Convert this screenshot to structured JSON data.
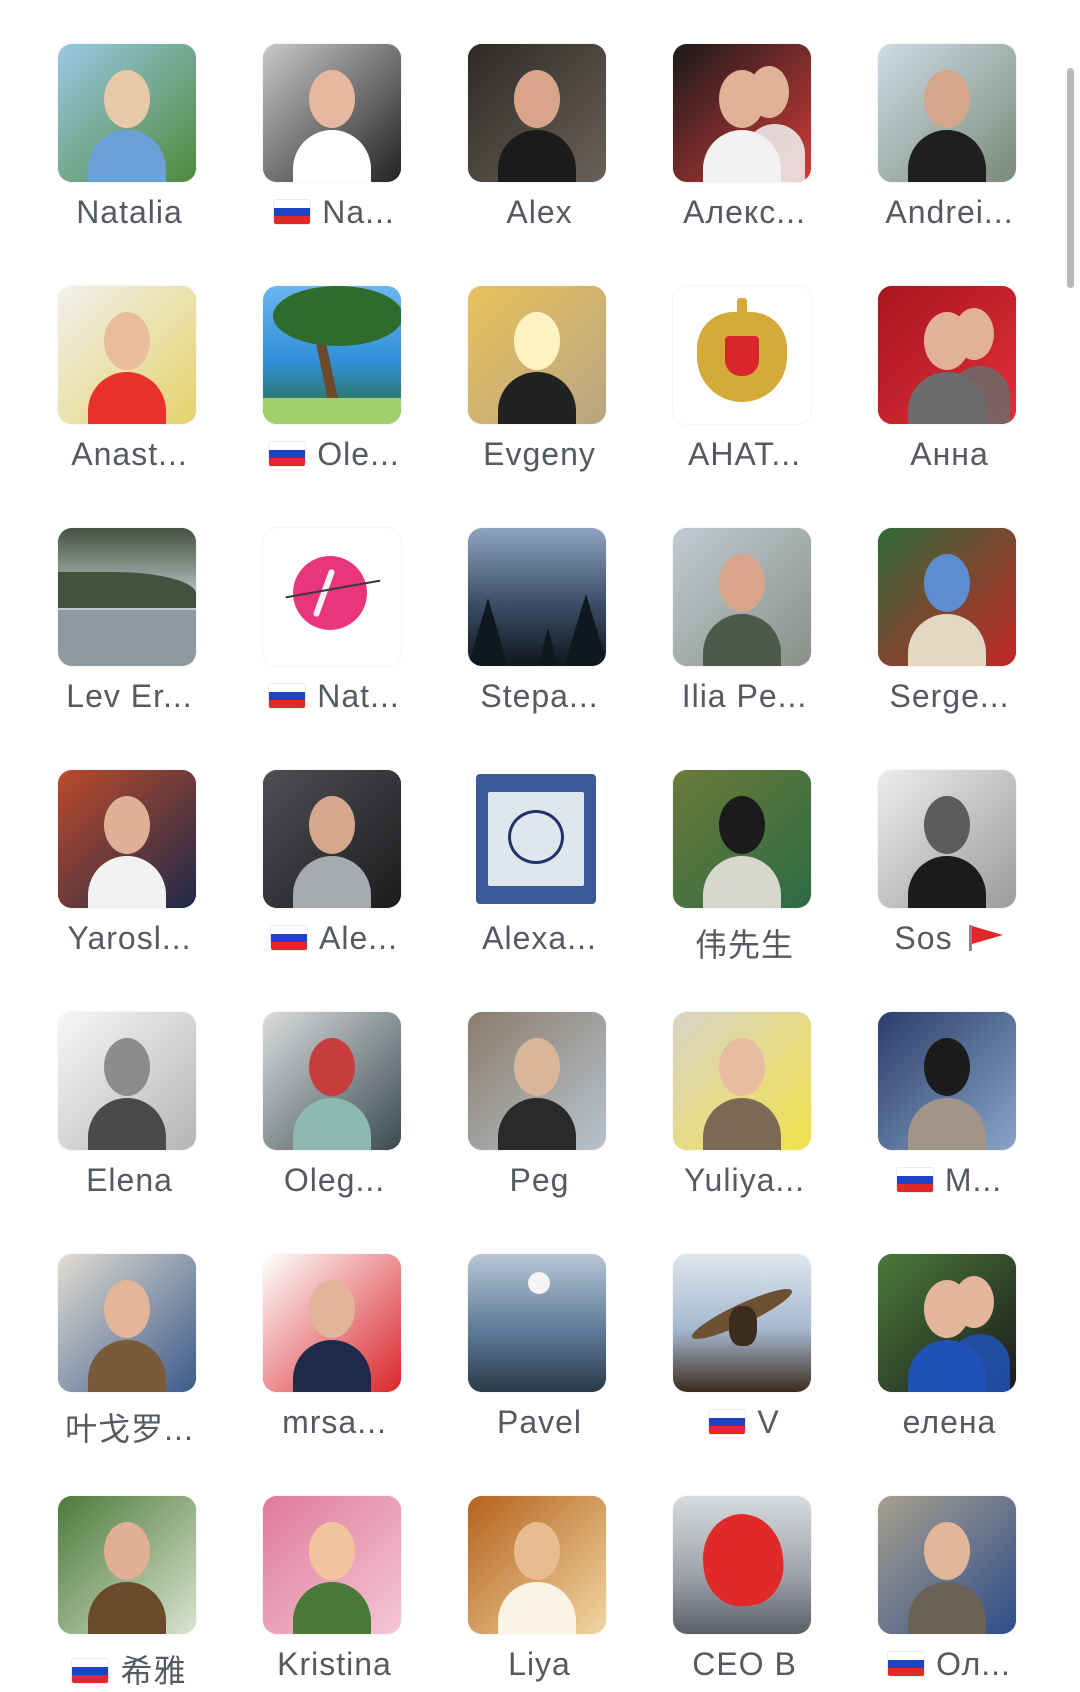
{
  "contacts": [
    {
      "name": "Natalia",
      "flag": false,
      "avatar": "woman-portrait",
      "colors": [
        "#9cc7e6",
        "#4f8a3b",
        "#6aa1d9",
        "#e7c9a8"
      ]
    },
    {
      "name": "Na...",
      "flag": true,
      "avatar": "woman-portrait",
      "colors": [
        "#c9c9c9",
        "#222222",
        "#ffffff",
        "#e6b8a0"
      ]
    },
    {
      "name": "Alex",
      "flag": false,
      "avatar": "man-portrait",
      "colors": [
        "#2d2a26",
        "#6b6158",
        "#1b1b1b",
        "#d9a58a"
      ]
    },
    {
      "name": "Алекс...",
      "flag": false,
      "avatar": "fighters",
      "colors": [
        "#1a1a1a",
        "#d23b3b",
        "#f2f2f2",
        "#e2b197"
      ]
    },
    {
      "name": "Andrei...",
      "flag": false,
      "avatar": "man-outdoor",
      "colors": [
        "#cfdbe6",
        "#7a8a7a",
        "#1f1f1f",
        "#d6a68a"
      ]
    },
    {
      "name": "Anast...",
      "flag": false,
      "avatar": "woman-red-dress",
      "colors": [
        "#f1f1ef",
        "#e5d26a",
        "#e8322b",
        "#e8bc9d"
      ]
    },
    {
      "name": "Ole...",
      "flag": true,
      "avatar": "palm-tree",
      "colors": [
        "#2f8fd8",
        "#6ab6ee",
        "#2f6b2a",
        "#a0d16f"
      ]
    },
    {
      "name": "Evgeny",
      "flag": false,
      "avatar": "man-corridor",
      "colors": [
        "#e9c25b",
        "#b9a584",
        "#222222",
        "#fff3c4"
      ]
    },
    {
      "name": "АНАТ...",
      "flag": false,
      "avatar": "coat-of-arms",
      "colors": [
        "#ffffff",
        "#d4aa3a",
        "#d8262b",
        "#1f3a8a"
      ]
    },
    {
      "name": "Анна",
      "flag": false,
      "avatar": "couple",
      "colors": [
        "#a8141e",
        "#e0303a",
        "#6b6b6b",
        "#e2b197"
      ]
    },
    {
      "name": "Lev Er...",
      "flag": false,
      "avatar": "misty-river",
      "colors": [
        "#c8cfd4",
        "#43513f",
        "#8f9aa0",
        "#5a6b5c"
      ]
    },
    {
      "name": "Nat...",
      "flag": true,
      "avatar": "ballet-logo",
      "colors": [
        "#ffffff",
        "#e8357b",
        "#3a3a3a",
        "#f4f4f4"
      ]
    },
    {
      "name": "Stepa...",
      "flag": false,
      "avatar": "night-forest",
      "colors": [
        "#3b4d67",
        "#8ea4c0",
        "#10181f",
        "#c7d2de"
      ]
    },
    {
      "name": "Ilia Pe...",
      "flag": false,
      "avatar": "man-waterfront",
      "colors": [
        "#c1ccd2",
        "#8a8f88",
        "#4d5a4a",
        "#d8a58a"
      ]
    },
    {
      "name": "Serge...",
      "flag": false,
      "avatar": "man-temple",
      "colors": [
        "#2f6a3a",
        "#c32826",
        "#e3d9c3",
        "#5c8ecf"
      ]
    },
    {
      "name": "Yarosl...",
      "flag": false,
      "avatar": "man-suit",
      "colors": [
        "#bd4a2a",
        "#1e2a4a",
        "#f2f2f2",
        "#e0b096"
      ]
    },
    {
      "name": "Ale...",
      "flag": true,
      "avatar": "man-cockpit",
      "colors": [
        "#4d4f52",
        "#1b1c1e",
        "#a7aaae",
        "#d5a78d"
      ]
    },
    {
      "name": "Alexa...",
      "flag": false,
      "avatar": "postage-stamp",
      "colors": [
        "#3b5a9a",
        "#dfe6f0",
        "#ffffff",
        "#1f3466"
      ]
    },
    {
      "name": "伟先生",
      "flag": false,
      "avatar": "man-mahjong",
      "colors": [
        "#6b7a3a",
        "#2d6b43",
        "#d6d8cf",
        "#1b1b1b"
      ]
    },
    {
      "name": "Sos",
      "flag": false,
      "trailing_flag": true,
      "avatar": "man-bw",
      "colors": [
        "#ececec",
        "#9b9b9b",
        "#1b1b1b",
        "#5c5c5c"
      ]
    },
    {
      "name": "Elena",
      "flag": false,
      "avatar": "woman-sketch",
      "colors": [
        "#f7f7f7",
        "#b5b5b5",
        "#4a4a4a",
        "#8c8c8c"
      ]
    },
    {
      "name": "Oleg...",
      "flag": false,
      "avatar": "man-mall",
      "colors": [
        "#dcdcdc",
        "#3a4b52",
        "#8fb9b0",
        "#c73c3c"
      ]
    },
    {
      "name": "Peg",
      "flag": false,
      "avatar": "man-old-town",
      "colors": [
        "#8b7d6c",
        "#b7c3cf",
        "#2a2a2a",
        "#d9b59a"
      ]
    },
    {
      "name": "Yuliya...",
      "flag": false,
      "avatar": "woman-selfie",
      "colors": [
        "#d9d4c8",
        "#f2e24a",
        "#7a6a55",
        "#e8bca0"
      ]
    },
    {
      "name": "M...",
      "flag": true,
      "avatar": "statue",
      "colors": [
        "#2a3e6a",
        "#8aa4c8",
        "#a39488",
        "#1b1b1b"
      ]
    },
    {
      "name": "叶戈罗...",
      "flag": false,
      "avatar": "man-temple-of-heaven",
      "colors": [
        "#e2ddd2",
        "#3b5a8a",
        "#7a5a3a",
        "#e3b699"
      ]
    },
    {
      "name": "mrsa...",
      "flag": false,
      "avatar": "man-podium",
      "colors": [
        "#ffffff",
        "#d8262b",
        "#1f2a4a",
        "#e2b59a"
      ]
    },
    {
      "name": "Pavel",
      "flag": false,
      "avatar": "sea-sunset",
      "colors": [
        "#5e7a98",
        "#b8c7d6",
        "#2b3a48",
        "#f4f4f4"
      ]
    },
    {
      "name": "V",
      "flag": true,
      "avatar": "eagle",
      "colors": [
        "#a4b8cf",
        "#dfe6ee",
        "#3b2c1e",
        "#6d5232"
      ]
    },
    {
      "name": "елена",
      "flag": false,
      "avatar": "couple-formal",
      "colors": [
        "#4b7a3a",
        "#1b1b1b",
        "#2152b8",
        "#e3b69b"
      ]
    },
    {
      "name": "希雅",
      "flag": true,
      "avatar": "man-greenhouse",
      "colors": [
        "#4c7a3a",
        "#d9e3d0",
        "#6b4a2a",
        "#e0b095"
      ]
    },
    {
      "name": "Kristina",
      "flag": false,
      "avatar": "woman-flowers",
      "colors": [
        "#e07a9a",
        "#f4c7d4",
        "#4a7a3a",
        "#efc49f"
      ]
    },
    {
      "name": "Liya",
      "flag": false,
      "avatar": "woman-golden",
      "colors": [
        "#b5621e",
        "#f1d7a2",
        "#fbf3e6",
        "#e8bb93"
      ]
    },
    {
      "name": "CEO B",
      "flag": false,
      "avatar": "red-heart-installation",
      "colors": [
        "#9aa0a6",
        "#e02a2a",
        "#5a5f66",
        "#d7dbe0"
      ]
    },
    {
      "name": "Ол...",
      "flag": true,
      "avatar": "woman-building",
      "colors": [
        "#a7a08f",
        "#2f4d8a",
        "#6b6154",
        "#e2b699"
      ]
    }
  ]
}
